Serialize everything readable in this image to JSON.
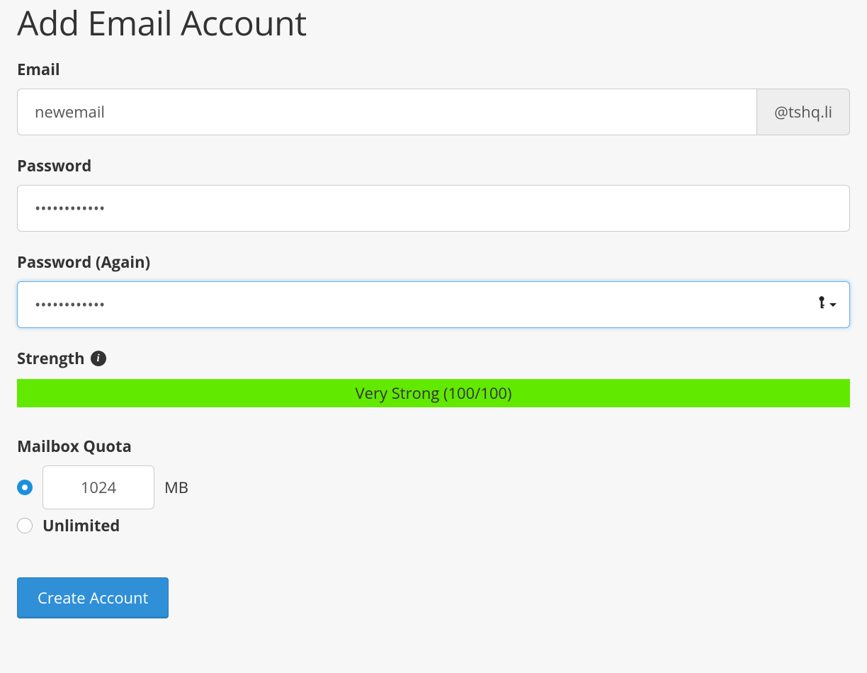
{
  "page": {
    "title": "Add Email Account"
  },
  "email": {
    "label": "Email",
    "value": "newemail",
    "domain_suffix": "@tshq.li"
  },
  "password": {
    "label": "Password",
    "value": "••••••••••••"
  },
  "password_again": {
    "label": "Password (Again)",
    "value": "••••••••••••"
  },
  "strength": {
    "label": "Strength",
    "text": "Very Strong (100/100)",
    "color": "#62e900"
  },
  "quota": {
    "label": "Mailbox Quota",
    "value": "1024",
    "unit": "MB",
    "unlimited_label": "Unlimited",
    "selected": "fixed"
  },
  "actions": {
    "create_label": "Create Account"
  }
}
